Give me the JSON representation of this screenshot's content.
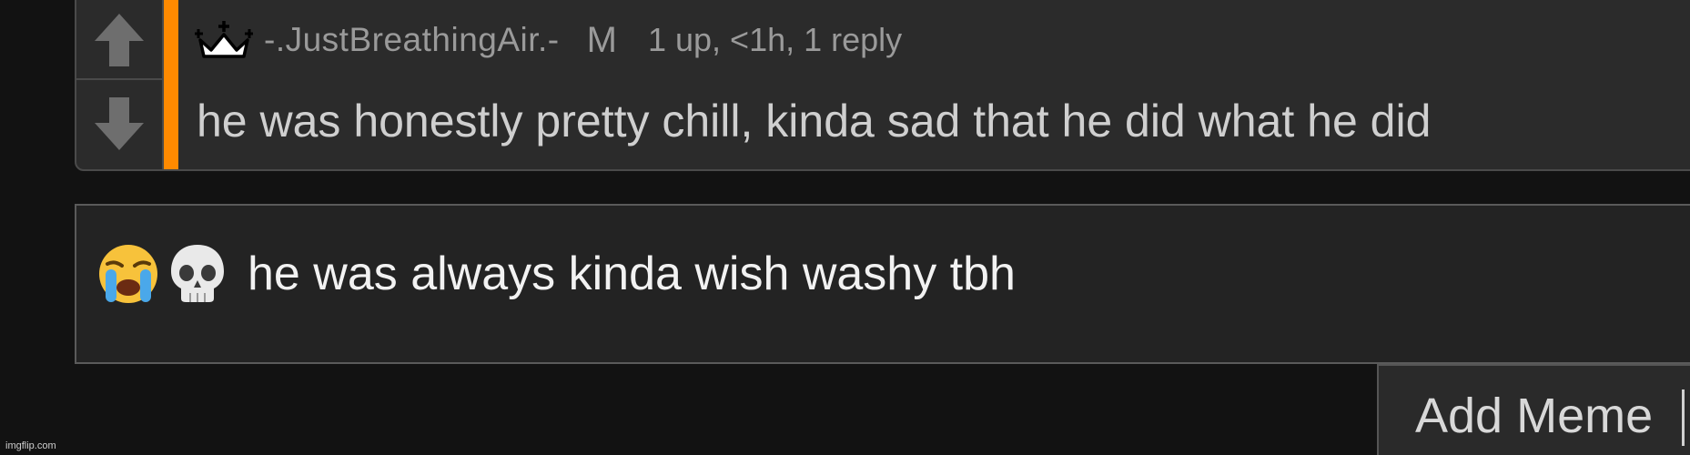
{
  "comment": {
    "username": "-.JustBreathingAir.-",
    "role_badge": "M",
    "meta": "1 up, <1h, 1 reply",
    "text": "he was honestly pretty chill, kinda sad that he did what he did",
    "crown_icon": "crown-icon",
    "accent_color": "#ff8a00"
  },
  "reply": {
    "emojis": [
      "loudly-crying-face",
      "skull"
    ],
    "text": "he was always kinda wish washy tbh"
  },
  "add_meme": {
    "label": "Add Meme"
  },
  "watermark": "imgflip.com"
}
